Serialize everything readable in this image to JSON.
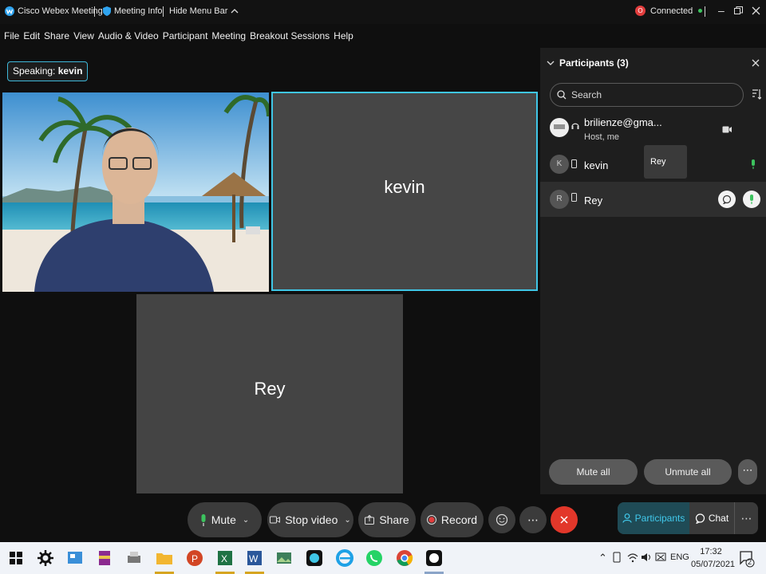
{
  "titlebar": {
    "app_name": "Cisco Webex Meetings",
    "meeting_info": "Meeting Info",
    "hide_menu": "Hide Menu Bar",
    "status": "Connected",
    "rec_badge": "O"
  },
  "menu": [
    "File",
    "Edit",
    "Share",
    "View",
    "Audio & Video",
    "Participant",
    "Meeting",
    "Breakout Sessions",
    "Help"
  ],
  "speaking": {
    "prefix": "Speaking:",
    "name": "kevin"
  },
  "tiles": {
    "kevin": "kevin",
    "rey": "Rey"
  },
  "panel": {
    "title": "Participants (3)",
    "search_placeholder": "Search",
    "participants": [
      {
        "name": "brilienze@gma...",
        "role": "Host, me",
        "initial": ""
      },
      {
        "name": "kevin",
        "initial": "K"
      },
      {
        "name": "Rey",
        "initial": "R"
      }
    ],
    "tooltip": "Rey",
    "mute_all": "Mute all",
    "unmute_all": "Unmute all"
  },
  "controls": {
    "mute": "Mute",
    "stop_video": "Stop video",
    "share": "Share",
    "record": "Record",
    "participants": "Participants",
    "chat": "Chat"
  },
  "taskbar": {
    "lang": "ENG",
    "time": "17:32",
    "date": "05/07/2021",
    "notif_count": "2"
  },
  "colors": {
    "accent": "#3fc6e6",
    "end_call": "#e2372a",
    "record_red": "#e23d3d",
    "connected_green": "#3cc35e"
  }
}
